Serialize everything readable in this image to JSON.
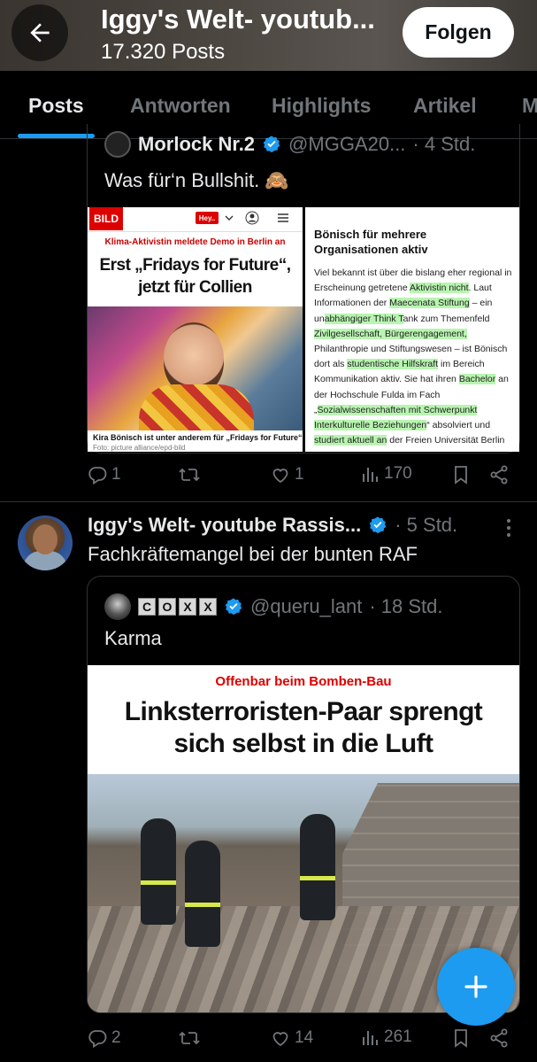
{
  "header": {
    "title": "Iggy's Welt- youtub...",
    "posts_count": "17.320 Posts",
    "follow_label": "Folgen"
  },
  "tabs": [
    {
      "label": "Posts",
      "active": true
    },
    {
      "label": "Antworten",
      "active": false
    },
    {
      "label": "Highlights",
      "active": false
    },
    {
      "label": "Artikel",
      "active": false
    },
    {
      "label": "M",
      "active": false
    }
  ],
  "post1": {
    "quoted": {
      "name": "Morlock Nr.2",
      "handle": "@MGGA20...",
      "time": "· 4 Std.",
      "text": "Was für‘n Bullshit. 🙈"
    },
    "image_left": {
      "logo": "BILD",
      "badge": "Hey..",
      "kicker": "Klima-Aktivistin meldete Demo in Berlin an",
      "headline": "Erst „Fridays for Future“, jetzt für Collien",
      "caption": "Kira Bönisch ist unter anderem für „Fridays for Future“ aktiv",
      "credit": "Foto: picture alliance/epd-bild"
    },
    "image_right": {
      "headline": "Bönisch für mehrere Organisationen aktiv",
      "body_parts": [
        {
          "t": "Viel bekannt ist über die bislang eher regional in Erscheinung getretene ",
          "h": false
        },
        {
          "t": "Aktivistin nicht",
          "h": true
        },
        {
          "t": ". Laut Informationen der ",
          "h": false
        },
        {
          "t": "Maecenata Stiftung",
          "h": true
        },
        {
          "t": " – ein un",
          "h": false
        },
        {
          "t": "abhängiger Think T",
          "h": true
        },
        {
          "t": "ank zum Themenfeld ",
          "h": false
        },
        {
          "t": "Zivilgesellschaft, Bürgerengagement,",
          "h": true
        },
        {
          "t": " Philanthropie und Stiftungswesen – ist Bönisch dort als ",
          "h": false
        },
        {
          "t": "studentische Hilfskraft",
          "h": true
        },
        {
          "t": " im Bereich Kommunikation aktiv. Sie hat ihren ",
          "h": false
        },
        {
          "t": "Bachelor",
          "h": true
        },
        {
          "t": " an der Hochschule Fulda im Fach „",
          "h": false
        },
        {
          "t": "Sozialwissenschaften mit Schwerpunkt Interkulturelle Beziehungen",
          "h": true
        },
        {
          "t": "“ absolviert und ",
          "h": false
        },
        {
          "t": "studiert aktuell an",
          "h": true
        },
        {
          "t": " der Freien Universität Berlin",
          "h": false
        }
      ]
    },
    "actions": {
      "replies": "1",
      "reposts": "",
      "likes": "1",
      "views": "170"
    }
  },
  "post2": {
    "name": "Iggy's Welt- youtube Rassis...",
    "time": "· 5 Std.",
    "text": "Fachkräftemangel bei der bunten RAF",
    "quoted": {
      "name_letters": [
        "C",
        "O",
        "X",
        "X"
      ],
      "handle": "@queru_lant",
      "time": "· 18 Std.",
      "text": "Karma"
    },
    "image": {
      "kicker": "Offenbar beim Bomben-Bau",
      "headline": "Linksterroristen-Paar sprengt sich selbst in die Luft"
    },
    "actions": {
      "replies": "2",
      "reposts": "",
      "likes": "14",
      "views": "261"
    }
  },
  "colors": {
    "accent": "#1d9bf0",
    "background": "#000000",
    "muted": "#71767b",
    "text": "#e7e9ea",
    "highlight": "#b8f5b0"
  },
  "icons": [
    "back-arrow-icon",
    "verified-badge-icon",
    "reply-icon",
    "repost-icon",
    "like-icon",
    "views-icon",
    "bookmark-icon",
    "share-icon",
    "more-icon",
    "compose-plus-icon"
  ]
}
